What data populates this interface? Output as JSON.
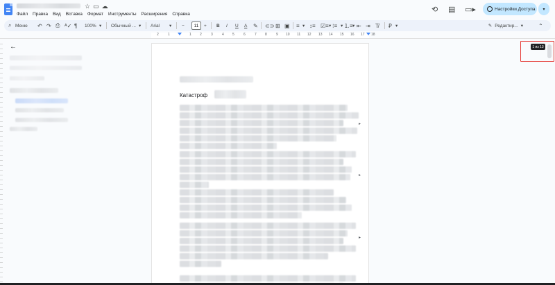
{
  "window": {
    "menu": [
      "Файл",
      "Правка",
      "Вид",
      "Вставка",
      "Формат",
      "Инструменты",
      "Расширения",
      "Справка"
    ],
    "share_label": "Настройки Доступа",
    "share_caret": "▾"
  },
  "toolbar": {
    "search_label": "Меню",
    "zoom": "100%",
    "style": "Обычный ...",
    "font": "Arial",
    "minus": "−",
    "font_size": "11",
    "plus": "+",
    "edit_mode": "Редактир...",
    "bold": "B",
    "italic": "I",
    "underline": "U",
    "text_color": "A"
  },
  "ruler": {
    "numbers": [
      "2",
      "1",
      "1",
      "2",
      "3",
      "4",
      "5",
      "6",
      "7",
      "8",
      "9",
      "10",
      "11",
      "12",
      "13",
      "14",
      "15",
      "16",
      "17",
      "18"
    ]
  },
  "page": {
    "subtitle": "Катастроф"
  },
  "page_indicator": {
    "label": "1 из 13"
  },
  "colors": {
    "accent": "#0b57d0",
    "share_bg": "#c2e7ff",
    "highlight": "#e53935",
    "toolbar_bg": "#edf2fa"
  }
}
